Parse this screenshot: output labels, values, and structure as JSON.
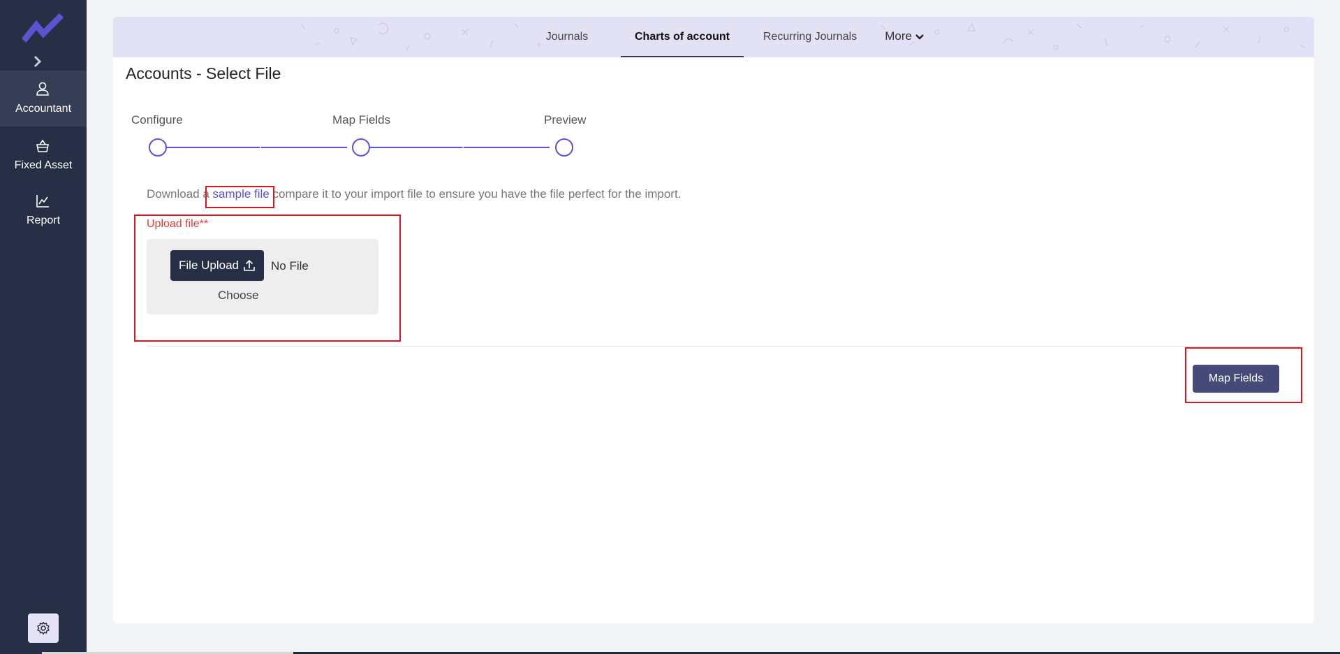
{
  "sidebar": {
    "logo_icon": "trend-logo-icon",
    "expand_icon": "chevron-right-icon",
    "items": [
      {
        "label": "Accountant",
        "icon": "user-icon",
        "active": true
      },
      {
        "label": "Fixed Asset",
        "icon": "basket-icon",
        "active": false
      },
      {
        "label": "Report",
        "icon": "chart-icon",
        "active": false
      }
    ],
    "settings_icon": "gear-icon"
  },
  "header": {
    "tabs": [
      {
        "label": "Journals",
        "active": false
      },
      {
        "label": "Charts of account",
        "active": true
      },
      {
        "label": "Recurring Journals",
        "active": false
      }
    ],
    "more_label": "More"
  },
  "page": {
    "title": "Accounts - Select File",
    "steps": [
      "Configure",
      "Map Fields",
      "Preview"
    ],
    "info_prefix": "Download a ",
    "info_link": "sample file",
    "info_suffix": " compare it to your import file to ensure you have the file perfect for the import.",
    "upload_label": "Upload file**",
    "upload_button": "File Upload",
    "no_file": "No File",
    "choose": "Choose",
    "map_fields_button": "Map Fields"
  },
  "colors": {
    "sidebar_bg": "#262f45",
    "accent": "#5b53d0",
    "primary_button": "#454a78",
    "highlight": "#e0121b",
    "required_label": "#e03a3a"
  }
}
